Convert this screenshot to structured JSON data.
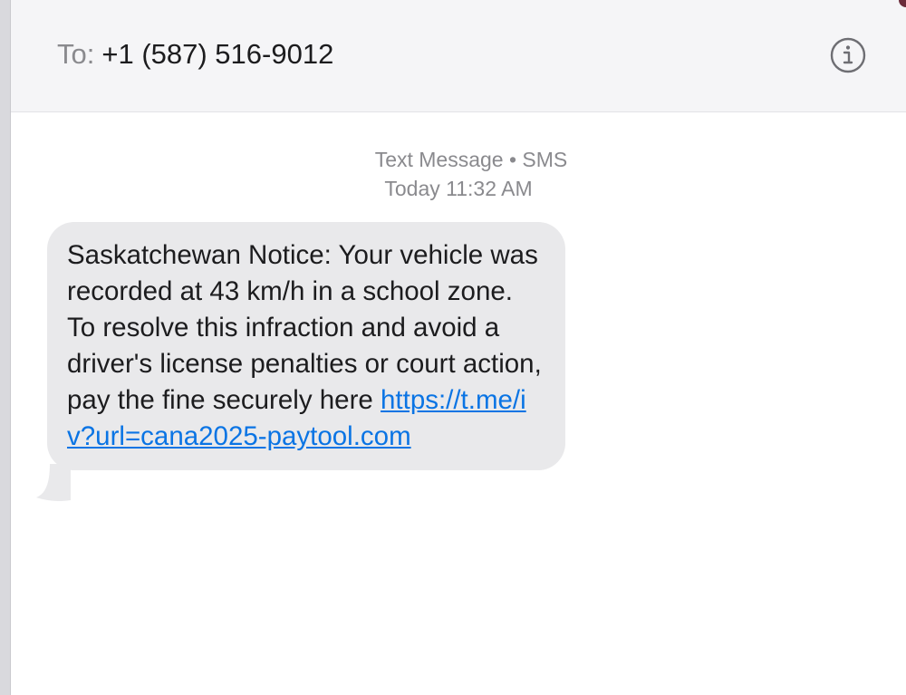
{
  "header": {
    "to_label": "To:",
    "recipient": "+1 (587) 516-9012",
    "info_icon": "info-circle-icon"
  },
  "conversation": {
    "service_label": "Text Message • SMS",
    "timestamp": "Today 11:32 AM"
  },
  "message": {
    "text": "Saskatchewan Notice: Your vehicle was recorded at 43 km/h in a school zone. To resolve this infraction and avoid a driver's license penalties or court action, pay the fine securely here ",
    "link": "https://t.me/iv?url=cana2025-paytool.com"
  },
  "colors": {
    "bubble": "#e9e9eb",
    "link": "#0a74e4",
    "header_bg": "#f5f5f7",
    "secondary_text": "#8a8a8e"
  }
}
